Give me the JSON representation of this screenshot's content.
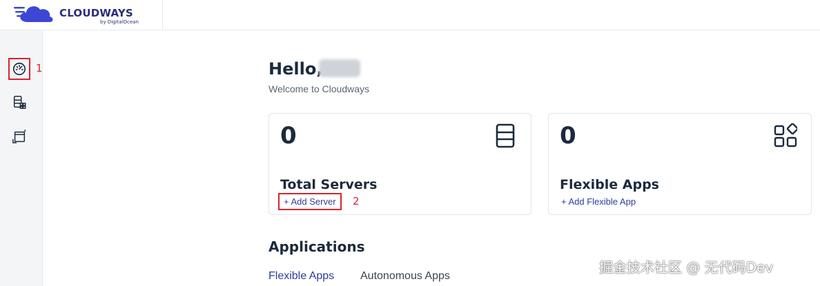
{
  "brand": {
    "name": "CLOUDWAYS",
    "sub": "by DigitalOcean",
    "color": "#2b2d7c"
  },
  "sidebar": {
    "items": [
      {
        "icon": "dashboard-gauge-icon",
        "active": true
      },
      {
        "icon": "servers-apps-icon",
        "active": false
      },
      {
        "icon": "applications-window-icon",
        "active": false
      }
    ]
  },
  "annotations": {
    "one": "1",
    "two": "2"
  },
  "greeting": {
    "hello": "Hello,",
    "welcome": "Welcome to Cloudways"
  },
  "cards": [
    {
      "count": "0",
      "title": "Total Servers",
      "link": "+ Add Server",
      "icon": "server-stack-icon"
    },
    {
      "count": "0",
      "title": "Flexible Apps",
      "link": "+ Add Flexible App",
      "icon": "apps-grid-icon"
    }
  ],
  "applications": {
    "heading": "Applications",
    "tabs": [
      "Flexible Apps",
      "Autonomous Apps"
    ]
  },
  "watermark": "掘金技术社区 @ 无代码Dev",
  "colors": {
    "accent": "#2e3ba0",
    "highlight": "#d9232e",
    "text": "#1b2a3c"
  }
}
